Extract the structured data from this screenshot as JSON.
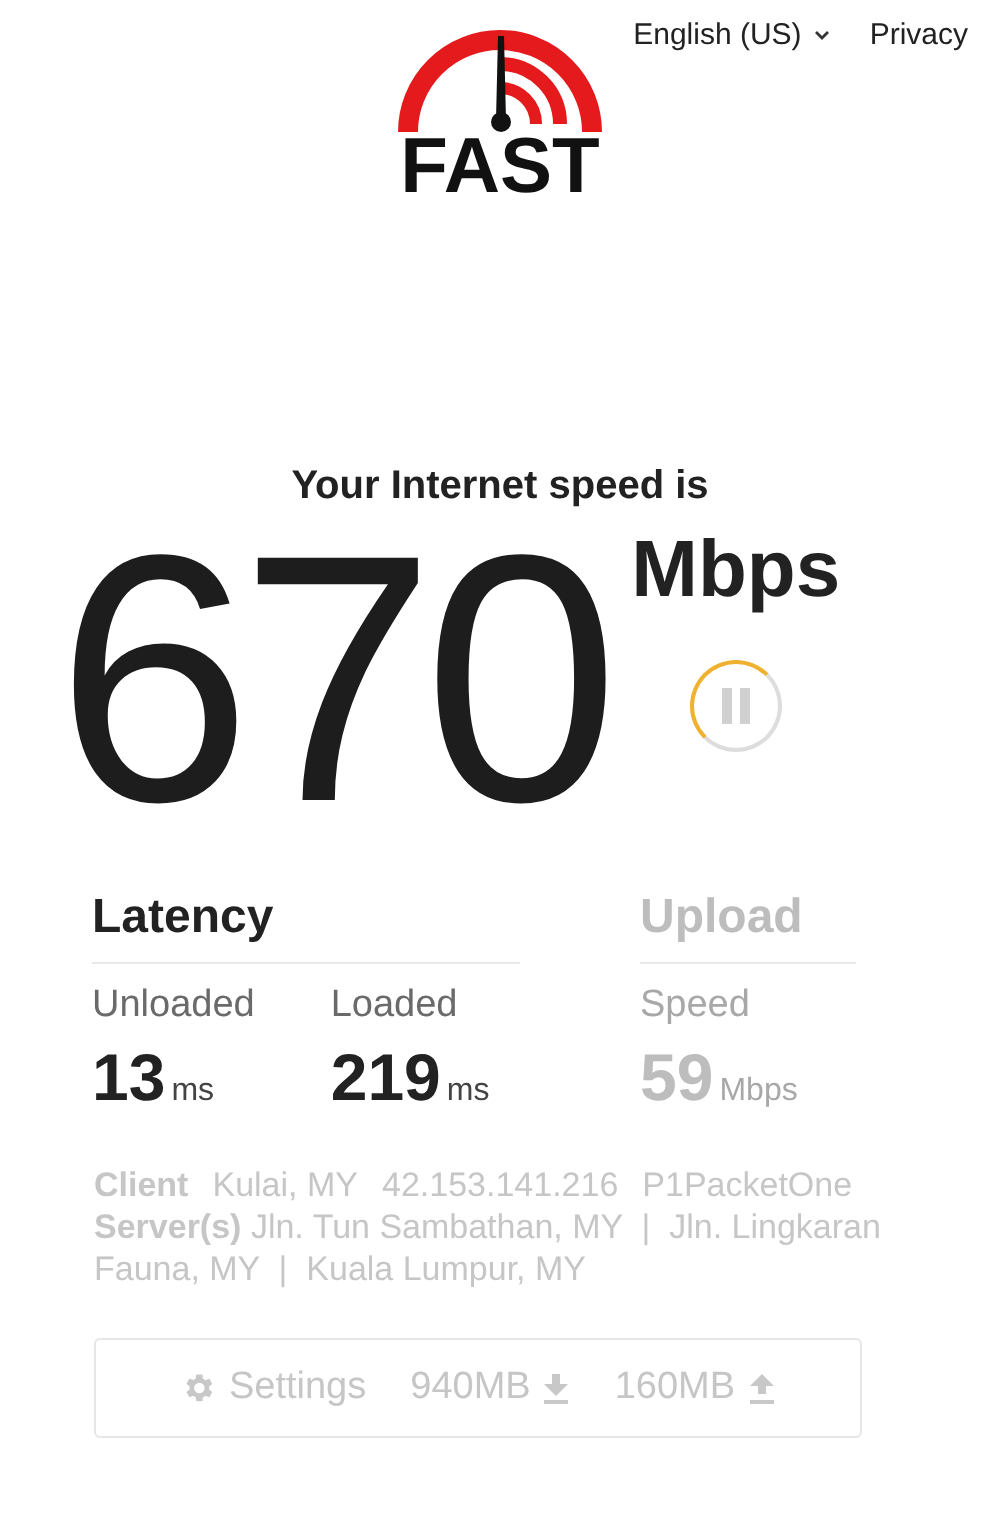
{
  "header": {
    "logo_text": "FAST",
    "language": "English (US)",
    "privacy": "Privacy"
  },
  "speed": {
    "caption": "Your Internet speed is",
    "value": "670",
    "unit": "Mbps",
    "paused": false
  },
  "sections": [
    {
      "kind": "latency",
      "title": "Latency",
      "active": true,
      "metrics": [
        {
          "label": "Unloaded",
          "value": "13",
          "unit": "ms"
        },
        {
          "label": "Loaded",
          "value": "219",
          "unit": "ms"
        }
      ]
    },
    {
      "kind": "upload",
      "title": "Upload",
      "active": false,
      "metrics": [
        {
          "label": "Speed",
          "value": "59",
          "unit": "Mbps"
        }
      ]
    }
  ],
  "client": {
    "label": "Client",
    "location": "Kulai, MY",
    "ip": "42.153.141.216",
    "isp": "P1PacketOne"
  },
  "servers": "**Server(s)** Jln. Tun Sambathan, MY  |  Jln. Lingkaran Fauna, MY  |  Kuala Lumpur, MY",
  "footer": {
    "settings": "Settings",
    "download": "940MB",
    "upload": "160MB"
  }
}
